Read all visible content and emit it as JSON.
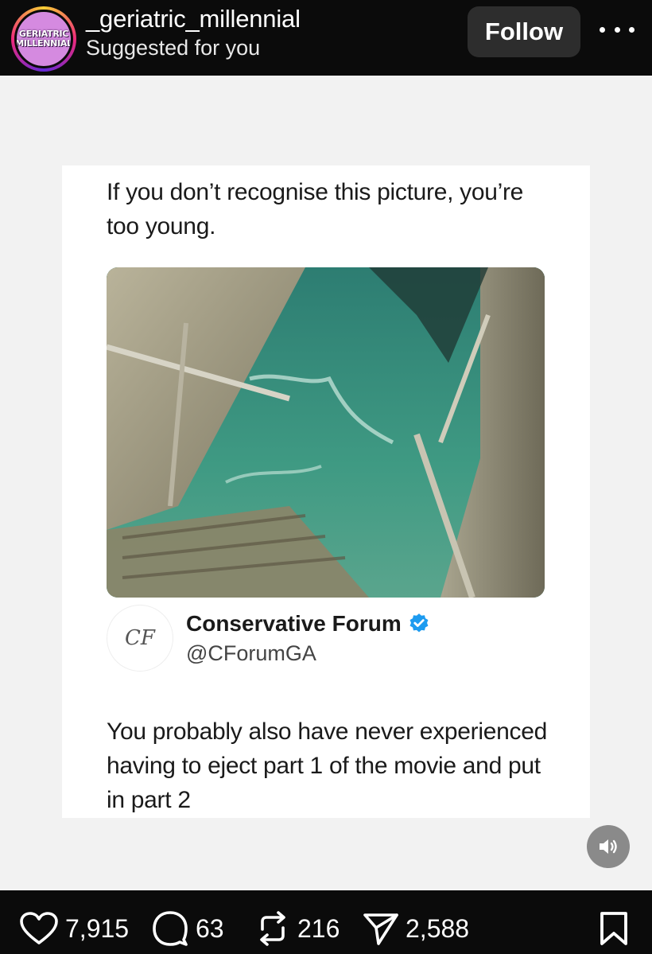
{
  "header": {
    "avatar_lines": [
      "GERIATRIC",
      "MILLENNIAL"
    ],
    "username": "_geriatric_millennial",
    "subtitle": "Suggested for you",
    "follow_label": "Follow"
  },
  "post": {
    "caption": "If you don’t recognise this picture, you’re too young.",
    "author": {
      "logo_text": "CF",
      "display_name": "Conservative Forum",
      "handle": "@CForumGA",
      "verified": true
    },
    "reply": "You probably also have never experienced having to eject part 1 of the movie and put in part 2"
  },
  "actions": {
    "likes": "7,915",
    "comments": "63",
    "reposts": "216",
    "shares": "2,588"
  },
  "colors": {
    "follow_bg": "#2d2d2d",
    "verified": "#1d9bf0",
    "water": "#3f8a78"
  },
  "icons": [
    "more-icon",
    "verified-icon",
    "sound-icon",
    "heart-icon",
    "comment-icon",
    "repost-icon",
    "share-icon",
    "bookmark-icon"
  ]
}
